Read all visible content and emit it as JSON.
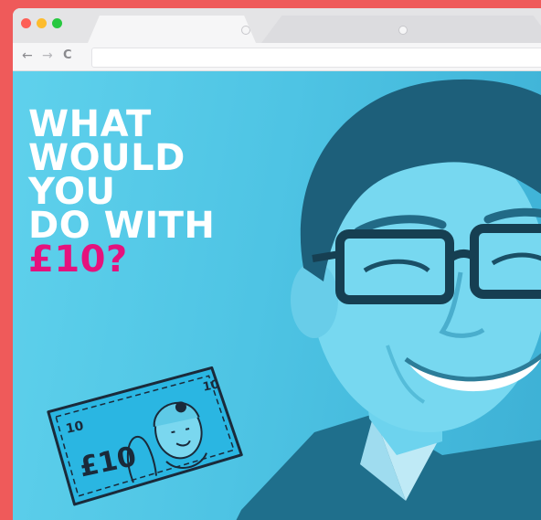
{
  "window": {
    "controls": [
      "close",
      "minimize",
      "zoom"
    ]
  },
  "tabs": [
    {
      "label": ""
    },
    {
      "label": ""
    }
  ],
  "toolbar": {
    "back_icon": "←",
    "forward_icon": "→",
    "reload_icon": "C",
    "url": ""
  },
  "hero": {
    "lines": [
      "WHAT",
      "WOULD",
      "YOU",
      "DO WITH"
    ],
    "accent": "£10?",
    "banknote_text": {
      "denomination_corner": "10",
      "value": "£10"
    }
  },
  "colors": {
    "background": "#ef5a5a",
    "hero_bg": "#4ec4e4",
    "accent": "#e5127d",
    "headline": "#ffffff"
  }
}
